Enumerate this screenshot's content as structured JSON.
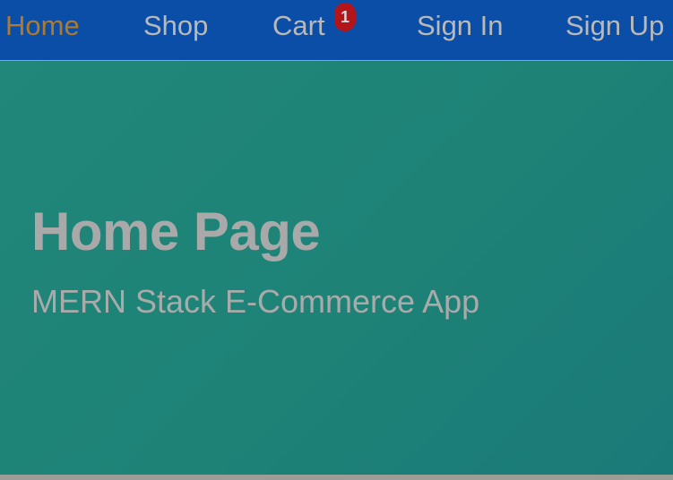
{
  "nav": {
    "items": [
      {
        "label": "Home",
        "active": true
      },
      {
        "label": "Shop",
        "active": false
      },
      {
        "label": "Cart",
        "active": false
      },
      {
        "label": "Sign In",
        "active": false
      },
      {
        "label": "Sign Up",
        "active": false
      }
    ],
    "cart_badge": "1"
  },
  "hero": {
    "title": "Home Page",
    "subtitle": "MERN Stack E-Commerce App"
  },
  "colors": {
    "navbar_bg": "#0a4ea8",
    "active_link": "#b07a2c",
    "inactive_link": "#b9b9b9",
    "badge_bg": "#b3161a",
    "hero_bg": "#1e8277"
  }
}
